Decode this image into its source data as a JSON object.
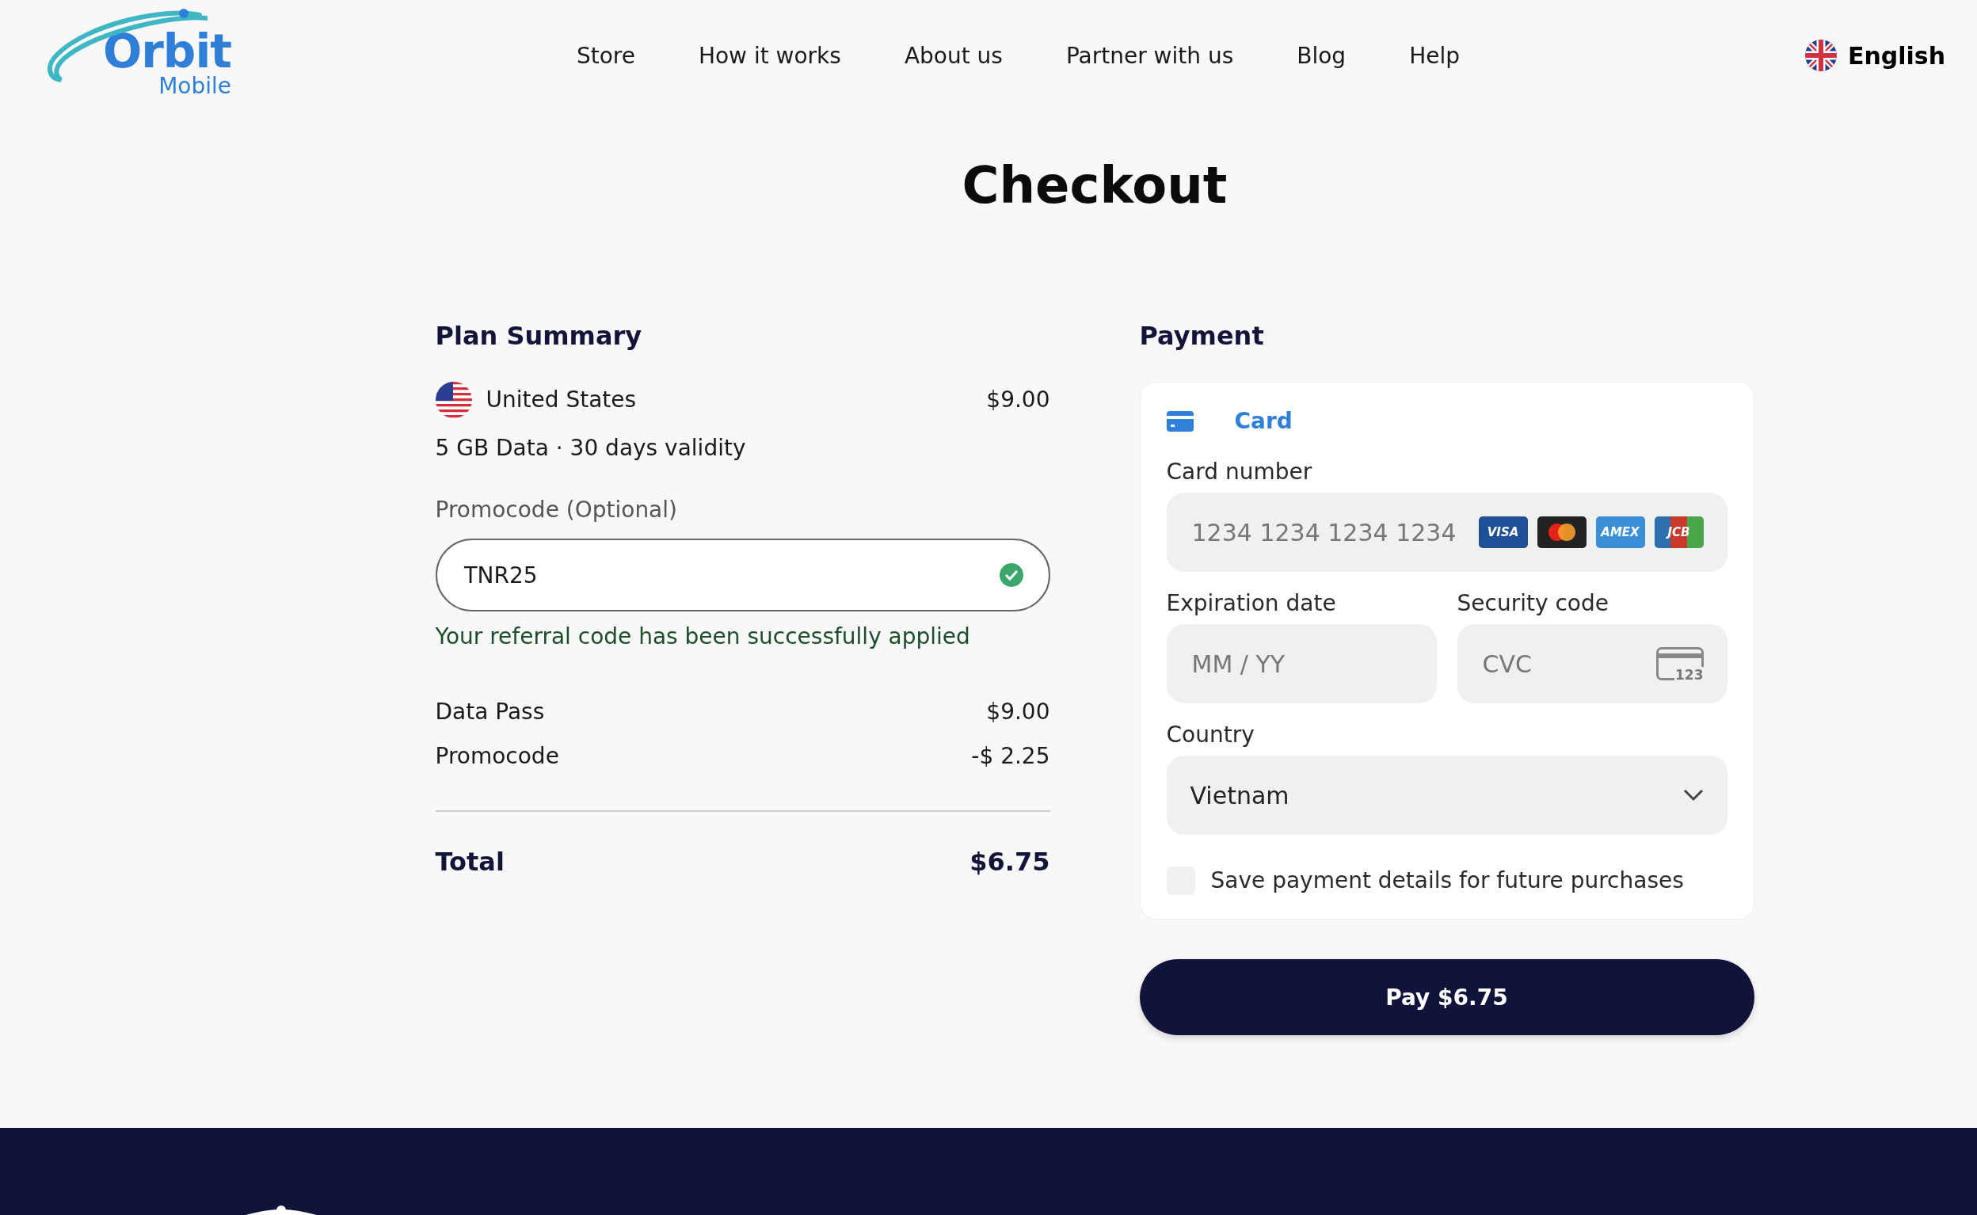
{
  "header": {
    "logo": {
      "word": "Orbit",
      "sub": "Mobile"
    },
    "nav": [
      "Store",
      "How it works",
      "About us",
      "Partner with us",
      "Blog",
      "Help"
    ],
    "language": "English"
  },
  "title": "Checkout",
  "plan_summary": {
    "heading": "Plan Summary",
    "country": "United States",
    "price": "$9.00",
    "details": "5 GB Data · 30 days validity",
    "promo": {
      "label": "Promocode (Optional)",
      "value": "TNR25",
      "applied": true,
      "message": "Your referral code has been successfully applied"
    },
    "lines": [
      {
        "label": "Data Pass",
        "amount": "$9.00"
      },
      {
        "label": "Promocode",
        "amount": "-$ 2.25"
      }
    ],
    "total": {
      "label": "Total",
      "amount": "$6.75"
    }
  },
  "payment": {
    "heading": "Payment",
    "tabs": [
      {
        "label": "Card",
        "selected": true
      }
    ],
    "card_number": {
      "label": "Card number",
      "placeholder": "1234 1234 1234 1234"
    },
    "card_brands": [
      {
        "kind": "visa",
        "label": "VISA"
      },
      {
        "kind": "mastercard"
      },
      {
        "kind": "amex",
        "label": "AMEX"
      },
      {
        "kind": "jcb",
        "label": "JCB"
      }
    ],
    "expiration": {
      "label": "Expiration date",
      "placeholder": "MM / YY"
    },
    "security": {
      "label": "Security code",
      "placeholder": "CVC",
      "icon_text": "123"
    },
    "country": {
      "label": "Country",
      "value": "Vietnam"
    },
    "save": {
      "label": "Save payment details for future purchases",
      "checked": false
    },
    "pay_button": "Pay $6.75"
  }
}
